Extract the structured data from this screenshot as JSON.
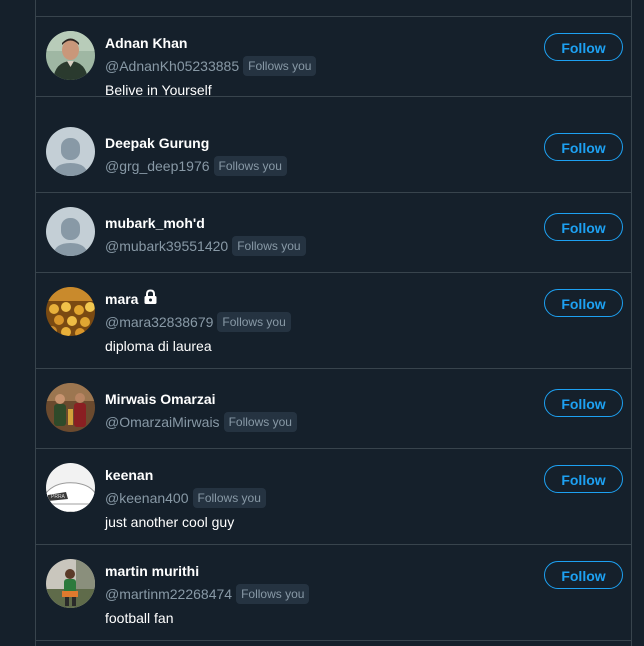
{
  "users": [
    {
      "name": "Adnan Khan",
      "handle": "@AdnanKh05233885",
      "badge": "Follows you",
      "bio": "Belive in Yourself",
      "button": "Follow",
      "avatar": "photo-man-portrait-icon"
    },
    {
      "name": "Deepak Gurung",
      "handle": "@grg_deep1976",
      "badge": "Follows you",
      "bio": "",
      "button": "Follow",
      "avatar": "default-avatar-icon"
    },
    {
      "name": "mubark_moh'd",
      "handle": "@mubark39551420",
      "badge": "Follows you",
      "bio": "",
      "button": "Follow",
      "avatar": "default-avatar-icon"
    },
    {
      "name": "mara",
      "handle": "@mara32838679",
      "badge": "Follows you",
      "bio": "diploma di laurea",
      "button": "Follow",
      "avatar": "photo-flowers-icon",
      "protected_icon": "lock-icon"
    },
    {
      "name": "Mirwais Omarzai",
      "handle": "@OmarzaiMirwais",
      "badge": "Follows you",
      "bio": "",
      "button": "Follow",
      "avatar": "photo-group-people-icon"
    },
    {
      "name": "keenan",
      "handle": "@keenan400",
      "badge": "Follows you",
      "bio": "just another cool guy",
      "button": "Follow",
      "avatar": "photo-car-icon"
    },
    {
      "name": "martin murithi",
      "handle": "@martinm22268474",
      "badge": "Follows you",
      "bio": "football fan",
      "button": "Follow",
      "avatar": "photo-person-outdoor-icon"
    }
  ],
  "colors": {
    "background": "#15202b",
    "border": "#38444d",
    "accent": "#1da1f2",
    "secondary_text": "#8899a6",
    "badge_bg": "#253341"
  }
}
